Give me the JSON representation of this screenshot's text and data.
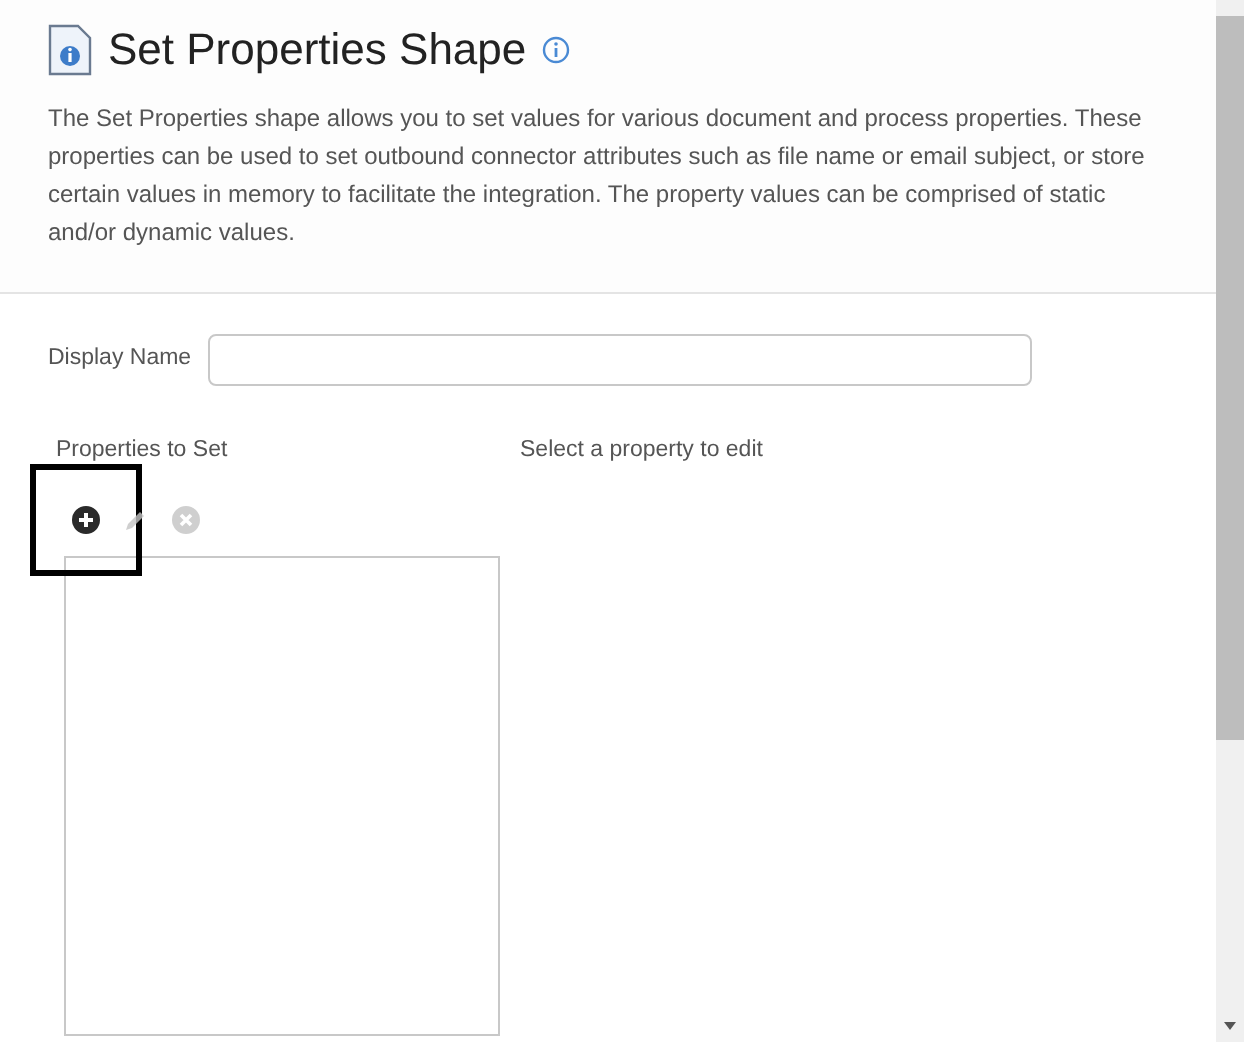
{
  "header": {
    "title": "Set Properties Shape",
    "description": "The Set Properties shape allows you to set values for various document and process properties. These properties can be used to set outbound connector attributes such as file name or email subject, or store certain values in memory to facilitate the integration. The property values can be comprised of static and/or dynamic values."
  },
  "display_name": {
    "label": "Display Name"
  },
  "properties": {
    "label": "Properties to Set",
    "toolbar": [
      {
        "kind": "add",
        "disabled": false,
        "highlighted": true
      },
      {
        "kind": "edit",
        "disabled": true,
        "highlighted": false
      },
      {
        "kind": "remove",
        "disabled": true,
        "highlighted": false
      }
    ]
  },
  "editor": {
    "hint": "Select a property to edit"
  }
}
